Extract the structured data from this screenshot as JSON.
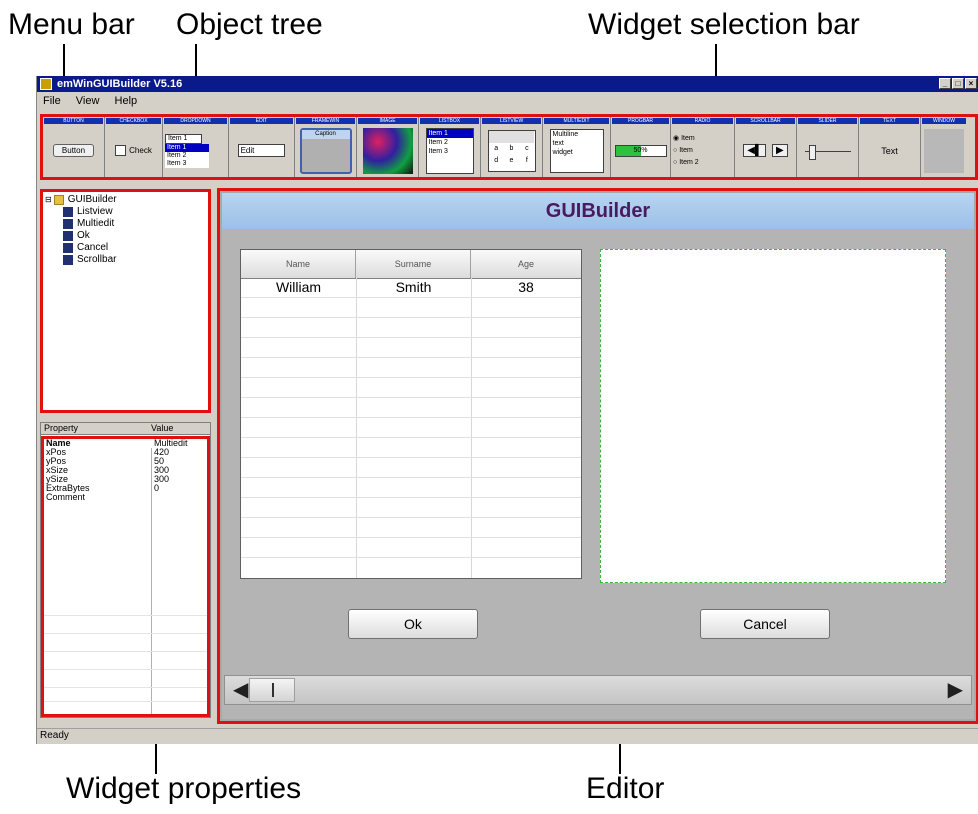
{
  "callouts": {
    "menu_bar": "Menu bar",
    "object_tree": "Object tree",
    "widget_selection_bar": "Widget selection bar",
    "widget_properties": "Widget properties",
    "editor": "Editor"
  },
  "window": {
    "title": "emWinGUIBuilder V5.16",
    "controls": [
      "_",
      "□",
      "×"
    ]
  },
  "menu": [
    "File",
    "View",
    "Help"
  ],
  "widget_bar": [
    {
      "header": "BUTTON",
      "icon": "button-widget-icon",
      "text": "Button"
    },
    {
      "header": "CHECKBOX",
      "icon": "checkbox-widget-icon",
      "text": "Check"
    },
    {
      "header": "DROPDOWN",
      "icon": "dropdown-widget-icon",
      "items": [
        "Item 1",
        "Item 1",
        "Item 2",
        "Item 3"
      ]
    },
    {
      "header": "EDIT",
      "icon": "edit-widget-icon",
      "text": "Edit"
    },
    {
      "header": "FRAMEWIN",
      "icon": "framewin-widget-icon",
      "text": "Caption"
    },
    {
      "header": "IMAGE",
      "icon": "image-widget-icon"
    },
    {
      "header": "LISTBOX",
      "icon": "listbox-widget-icon",
      "items": [
        "Item 1",
        "Item 2",
        "Item 3"
      ]
    },
    {
      "header": "LISTVIEW",
      "icon": "listview-widget-icon",
      "cells": [
        "a",
        "b",
        "c",
        "d",
        "e",
        "f"
      ]
    },
    {
      "header": "MULTIEDIT",
      "icon": "multiedit-widget-icon",
      "lines": [
        "Multiline",
        "text",
        "widget"
      ]
    },
    {
      "header": "PROGBAR",
      "icon": "progbar-widget-icon",
      "text": "50%",
      "progress": 0.5
    },
    {
      "header": "RADIO",
      "icon": "radio-widget-icon",
      "items": [
        "Item",
        "Item",
        "Item 2"
      ]
    },
    {
      "header": "SCROLLBAR",
      "icon": "scrollbar-widget-icon"
    },
    {
      "header": "SLIDER",
      "icon": "slider-widget-icon"
    },
    {
      "header": "TEXT",
      "icon": "text-widget-icon",
      "text": "Text"
    },
    {
      "header": "WINDOW",
      "icon": "window-widget-icon"
    }
  ],
  "tree": {
    "root": "GUIBuilder",
    "children": [
      "Listview",
      "Multiedit",
      "Ok",
      "Cancel",
      "Scrollbar"
    ]
  },
  "properties": {
    "header": {
      "property": "Property",
      "value": "Value"
    },
    "rows": [
      {
        "name": "Name",
        "value": "Multiedit"
      },
      {
        "name": "xPos",
        "value": "420"
      },
      {
        "name": "yPos",
        "value": "50"
      },
      {
        "name": "xSize",
        "value": "300"
      },
      {
        "name": "ySize",
        "value": "300"
      },
      {
        "name": "ExtraBytes",
        "value": "0"
      },
      {
        "name": "Comment",
        "value": ""
      }
    ]
  },
  "editor": {
    "caption": "GUIBuilder",
    "listview": {
      "columns": [
        "Name",
        "Surname",
        "Age"
      ],
      "rows": [
        [
          "William",
          "Smith",
          "38"
        ]
      ]
    },
    "ok_label": "Ok",
    "cancel_label": "Cancel"
  },
  "status": "Ready",
  "colors": {
    "highlight": "#e01010",
    "title_bar": "#0a1a8a",
    "caption_text": "#4a1a60"
  }
}
